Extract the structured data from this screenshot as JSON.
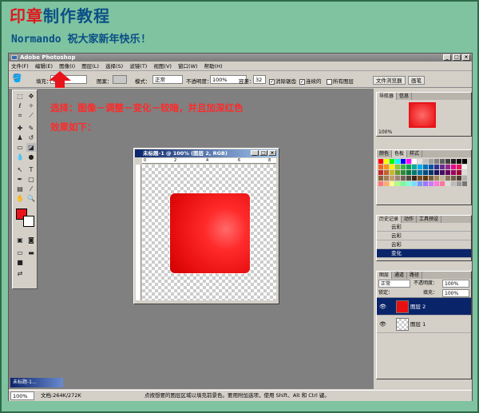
{
  "banner": {
    "title_part1": "印章",
    "title_part2": "制作教程",
    "subtitle": "Normando 祝大家新年快乐!"
  },
  "app": {
    "title": "Adobe Photoshop",
    "win_min": "_",
    "win_max": "□",
    "win_close": "×"
  },
  "menu": [
    "文件(F)",
    "编辑(E)",
    "图像(I)",
    "图层(L)",
    "选择(S)",
    "滤镜(T)",
    "视图(V)",
    "窗口(W)",
    "帮助(H)"
  ],
  "options": {
    "fill_label": "填充：",
    "fill_value": "前景",
    "pattern_label": "图案：",
    "mode_label": "模式：",
    "mode_value": "正常",
    "opacity_label": "不透明度：",
    "opacity_value": "100%",
    "tolerance_label": "容差：",
    "tolerance_value": "32",
    "antialias": "消除锯齿",
    "contiguous": "连续的",
    "all_layers": "所有图层",
    "tab_file_browser": "文件浏览器",
    "tab_brushes": "画笔"
  },
  "annotation": {
    "line1": "选择：图像－调整－变化－较暗，并且加深红色",
    "line2": "效果如下："
  },
  "document": {
    "title": "未标题-1 @ 100% (图层 2, RGB)",
    "ruler_marks": [
      "0",
      "2",
      "4",
      "6",
      "8"
    ]
  },
  "navigator": {
    "tabs": [
      "导航器",
      "信息"
    ],
    "zoom": "100%"
  },
  "color_panel": {
    "tabs": [
      "颜色",
      "色板",
      "样式"
    ],
    "swatch_colors": [
      "#ff0000",
      "#ffff00",
      "#00ff00",
      "#00ffff",
      "#0000ff",
      "#ff00ff",
      "#ffffff",
      "#e0e0e0",
      "#c0c0c0",
      "#a0a0a0",
      "#808080",
      "#606060",
      "#404040",
      "#202020",
      "#101010",
      "#000000",
      "#f26522",
      "#f7941d",
      "#fff200",
      "#8dc63f",
      "#39b54a",
      "#00a651",
      "#00a99d",
      "#00aeef",
      "#0072bc",
      "#0054a6",
      "#2e3192",
      "#662d91",
      "#92278f",
      "#ec008c",
      "#ed145b",
      "#f1f1f1",
      "#c1272d",
      "#c4622d",
      "#c7b82d",
      "#6b9b2d",
      "#2d8a3a",
      "#007a3d",
      "#00776f",
      "#0076a3",
      "#004b80",
      "#003471",
      "#1b1464",
      "#440e62",
      "#630460",
      "#9e005d",
      "#9e0039",
      "#dcdcdc",
      "#8c6239",
      "#a67c52",
      "#c69c6d",
      "#998675",
      "#736357",
      "#534741",
      "#3c2415",
      "#754c24",
      "#603913",
      "#7a5c3b",
      "#a3875f",
      "#c2b59b",
      "#8a7560",
      "#6f5b4a",
      "#4f3f33",
      "#b0b0b0",
      "#ff7777",
      "#ffaa77",
      "#ffff88",
      "#aaff88",
      "#77ff99",
      "#77ffdd",
      "#77ddff",
      "#7799ff",
      "#9977ff",
      "#cc77ff",
      "#ff77dd",
      "#ff7799",
      "#dddddd",
      "#bbbbbb",
      "#999999",
      "#777777"
    ]
  },
  "history": {
    "tabs": [
      "历史记录",
      "动作",
      "工具预设"
    ],
    "items": [
      "云彩",
      "云彩",
      "云彩",
      "变化"
    ]
  },
  "layers": {
    "tabs": [
      "图层",
      "通道",
      "路径"
    ],
    "blend": "正常",
    "opacity_label": "不透明度：",
    "opacity_value": "100%",
    "lock_label": "锁定：",
    "fill_label": "填充：",
    "fill_value": "100%",
    "items": [
      "图层 2",
      "图层 1"
    ]
  },
  "status": {
    "zoom": "100%",
    "doc": "文档:264K/272K",
    "hint": "点按想要的图层区域以填充前景色。要用附加选项，使用 Shift、Alt 和 Ctrl 键。",
    "mini_doc": "未标题-1..."
  }
}
